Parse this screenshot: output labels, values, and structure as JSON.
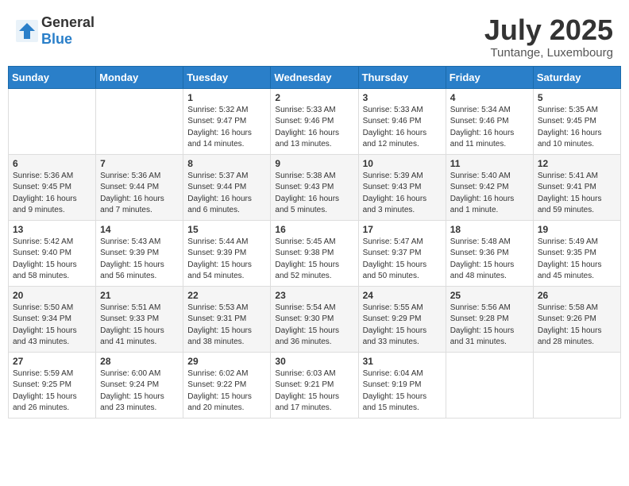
{
  "header": {
    "logo_general": "General",
    "logo_blue": "Blue",
    "month_title": "July 2025",
    "location": "Tuntange, Luxembourg"
  },
  "days_of_week": [
    "Sunday",
    "Monday",
    "Tuesday",
    "Wednesday",
    "Thursday",
    "Friday",
    "Saturday"
  ],
  "weeks": [
    [
      {
        "day": "",
        "sunrise": "",
        "sunset": "",
        "daylight": ""
      },
      {
        "day": "",
        "sunrise": "",
        "sunset": "",
        "daylight": ""
      },
      {
        "day": "1",
        "sunrise": "Sunrise: 5:32 AM",
        "sunset": "Sunset: 9:47 PM",
        "daylight": "Daylight: 16 hours and 14 minutes."
      },
      {
        "day": "2",
        "sunrise": "Sunrise: 5:33 AM",
        "sunset": "Sunset: 9:46 PM",
        "daylight": "Daylight: 16 hours and 13 minutes."
      },
      {
        "day": "3",
        "sunrise": "Sunrise: 5:33 AM",
        "sunset": "Sunset: 9:46 PM",
        "daylight": "Daylight: 16 hours and 12 minutes."
      },
      {
        "day": "4",
        "sunrise": "Sunrise: 5:34 AM",
        "sunset": "Sunset: 9:46 PM",
        "daylight": "Daylight: 16 hours and 11 minutes."
      },
      {
        "day": "5",
        "sunrise": "Sunrise: 5:35 AM",
        "sunset": "Sunset: 9:45 PM",
        "daylight": "Daylight: 16 hours and 10 minutes."
      }
    ],
    [
      {
        "day": "6",
        "sunrise": "Sunrise: 5:36 AM",
        "sunset": "Sunset: 9:45 PM",
        "daylight": "Daylight: 16 hours and 9 minutes."
      },
      {
        "day": "7",
        "sunrise": "Sunrise: 5:36 AM",
        "sunset": "Sunset: 9:44 PM",
        "daylight": "Daylight: 16 hours and 7 minutes."
      },
      {
        "day": "8",
        "sunrise": "Sunrise: 5:37 AM",
        "sunset": "Sunset: 9:44 PM",
        "daylight": "Daylight: 16 hours and 6 minutes."
      },
      {
        "day": "9",
        "sunrise": "Sunrise: 5:38 AM",
        "sunset": "Sunset: 9:43 PM",
        "daylight": "Daylight: 16 hours and 5 minutes."
      },
      {
        "day": "10",
        "sunrise": "Sunrise: 5:39 AM",
        "sunset": "Sunset: 9:43 PM",
        "daylight": "Daylight: 16 hours and 3 minutes."
      },
      {
        "day": "11",
        "sunrise": "Sunrise: 5:40 AM",
        "sunset": "Sunset: 9:42 PM",
        "daylight": "Daylight: 16 hours and 1 minute."
      },
      {
        "day": "12",
        "sunrise": "Sunrise: 5:41 AM",
        "sunset": "Sunset: 9:41 PM",
        "daylight": "Daylight: 15 hours and 59 minutes."
      }
    ],
    [
      {
        "day": "13",
        "sunrise": "Sunrise: 5:42 AM",
        "sunset": "Sunset: 9:40 PM",
        "daylight": "Daylight: 15 hours and 58 minutes."
      },
      {
        "day": "14",
        "sunrise": "Sunrise: 5:43 AM",
        "sunset": "Sunset: 9:39 PM",
        "daylight": "Daylight: 15 hours and 56 minutes."
      },
      {
        "day": "15",
        "sunrise": "Sunrise: 5:44 AM",
        "sunset": "Sunset: 9:39 PM",
        "daylight": "Daylight: 15 hours and 54 minutes."
      },
      {
        "day": "16",
        "sunrise": "Sunrise: 5:45 AM",
        "sunset": "Sunset: 9:38 PM",
        "daylight": "Daylight: 15 hours and 52 minutes."
      },
      {
        "day": "17",
        "sunrise": "Sunrise: 5:47 AM",
        "sunset": "Sunset: 9:37 PM",
        "daylight": "Daylight: 15 hours and 50 minutes."
      },
      {
        "day": "18",
        "sunrise": "Sunrise: 5:48 AM",
        "sunset": "Sunset: 9:36 PM",
        "daylight": "Daylight: 15 hours and 48 minutes."
      },
      {
        "day": "19",
        "sunrise": "Sunrise: 5:49 AM",
        "sunset": "Sunset: 9:35 PM",
        "daylight": "Daylight: 15 hours and 45 minutes."
      }
    ],
    [
      {
        "day": "20",
        "sunrise": "Sunrise: 5:50 AM",
        "sunset": "Sunset: 9:34 PM",
        "daylight": "Daylight: 15 hours and 43 minutes."
      },
      {
        "day": "21",
        "sunrise": "Sunrise: 5:51 AM",
        "sunset": "Sunset: 9:33 PM",
        "daylight": "Daylight: 15 hours and 41 minutes."
      },
      {
        "day": "22",
        "sunrise": "Sunrise: 5:53 AM",
        "sunset": "Sunset: 9:31 PM",
        "daylight": "Daylight: 15 hours and 38 minutes."
      },
      {
        "day": "23",
        "sunrise": "Sunrise: 5:54 AM",
        "sunset": "Sunset: 9:30 PM",
        "daylight": "Daylight: 15 hours and 36 minutes."
      },
      {
        "day": "24",
        "sunrise": "Sunrise: 5:55 AM",
        "sunset": "Sunset: 9:29 PM",
        "daylight": "Daylight: 15 hours and 33 minutes."
      },
      {
        "day": "25",
        "sunrise": "Sunrise: 5:56 AM",
        "sunset": "Sunset: 9:28 PM",
        "daylight": "Daylight: 15 hours and 31 minutes."
      },
      {
        "day": "26",
        "sunrise": "Sunrise: 5:58 AM",
        "sunset": "Sunset: 9:26 PM",
        "daylight": "Daylight: 15 hours and 28 minutes."
      }
    ],
    [
      {
        "day": "27",
        "sunrise": "Sunrise: 5:59 AM",
        "sunset": "Sunset: 9:25 PM",
        "daylight": "Daylight: 15 hours and 26 minutes."
      },
      {
        "day": "28",
        "sunrise": "Sunrise: 6:00 AM",
        "sunset": "Sunset: 9:24 PM",
        "daylight": "Daylight: 15 hours and 23 minutes."
      },
      {
        "day": "29",
        "sunrise": "Sunrise: 6:02 AM",
        "sunset": "Sunset: 9:22 PM",
        "daylight": "Daylight: 15 hours and 20 minutes."
      },
      {
        "day": "30",
        "sunrise": "Sunrise: 6:03 AM",
        "sunset": "Sunset: 9:21 PM",
        "daylight": "Daylight: 15 hours and 17 minutes."
      },
      {
        "day": "31",
        "sunrise": "Sunrise: 6:04 AM",
        "sunset": "Sunset: 9:19 PM",
        "daylight": "Daylight: 15 hours and 15 minutes."
      },
      {
        "day": "",
        "sunrise": "",
        "sunset": "",
        "daylight": ""
      },
      {
        "day": "",
        "sunrise": "",
        "sunset": "",
        "daylight": ""
      }
    ]
  ]
}
